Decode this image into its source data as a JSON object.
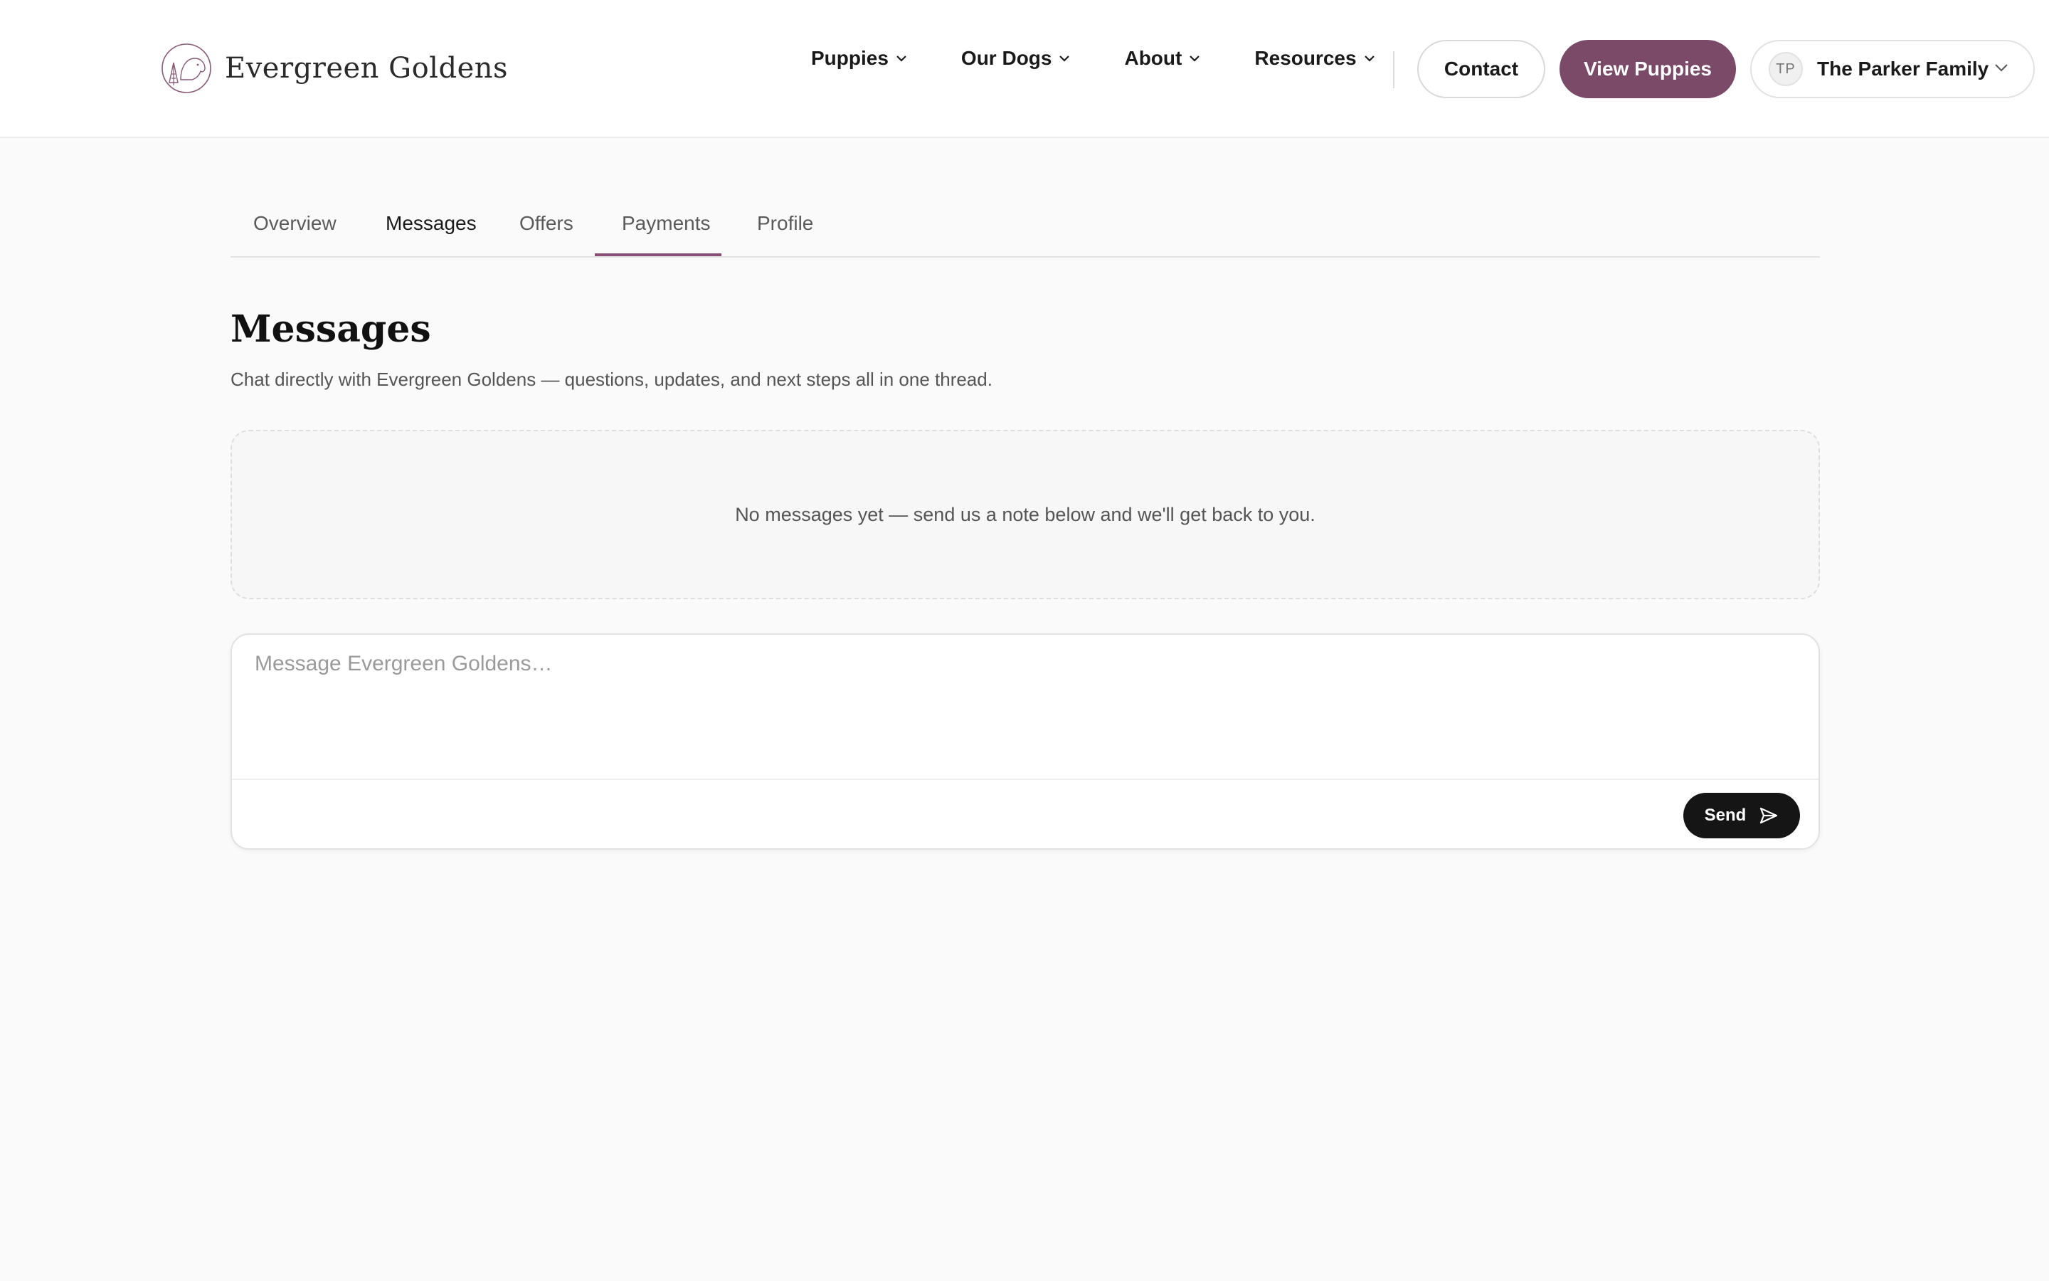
{
  "brand": {
    "name": "Evergreen Goldens",
    "logo_icon": "dog-tree-logo",
    "accent": "#7a4a68"
  },
  "nav": {
    "items": [
      {
        "label": "Puppies"
      },
      {
        "label": "Our Dogs"
      },
      {
        "label": "About"
      },
      {
        "label": "Resources"
      }
    ],
    "contact_label": "Contact",
    "cta_label": "View Puppies"
  },
  "account": {
    "initials": "TP",
    "name": "The Parker Family"
  },
  "tabs": [
    {
      "label": "Overview"
    },
    {
      "label": "Messages",
      "active": true
    },
    {
      "label": "Offers"
    },
    {
      "label": "Payments"
    },
    {
      "label": "Profile"
    }
  ],
  "page": {
    "title": "Messages",
    "subtitle": "Chat directly with Evergreen Goldens — questions, updates, and next steps all in one thread.",
    "empty_state": "No messages yet — send us a note below and we'll get back to you."
  },
  "composer": {
    "value": "",
    "placeholder": "Message Evergreen Goldens…",
    "send_label": "Send",
    "send_icon": "paper-plane-icon"
  }
}
